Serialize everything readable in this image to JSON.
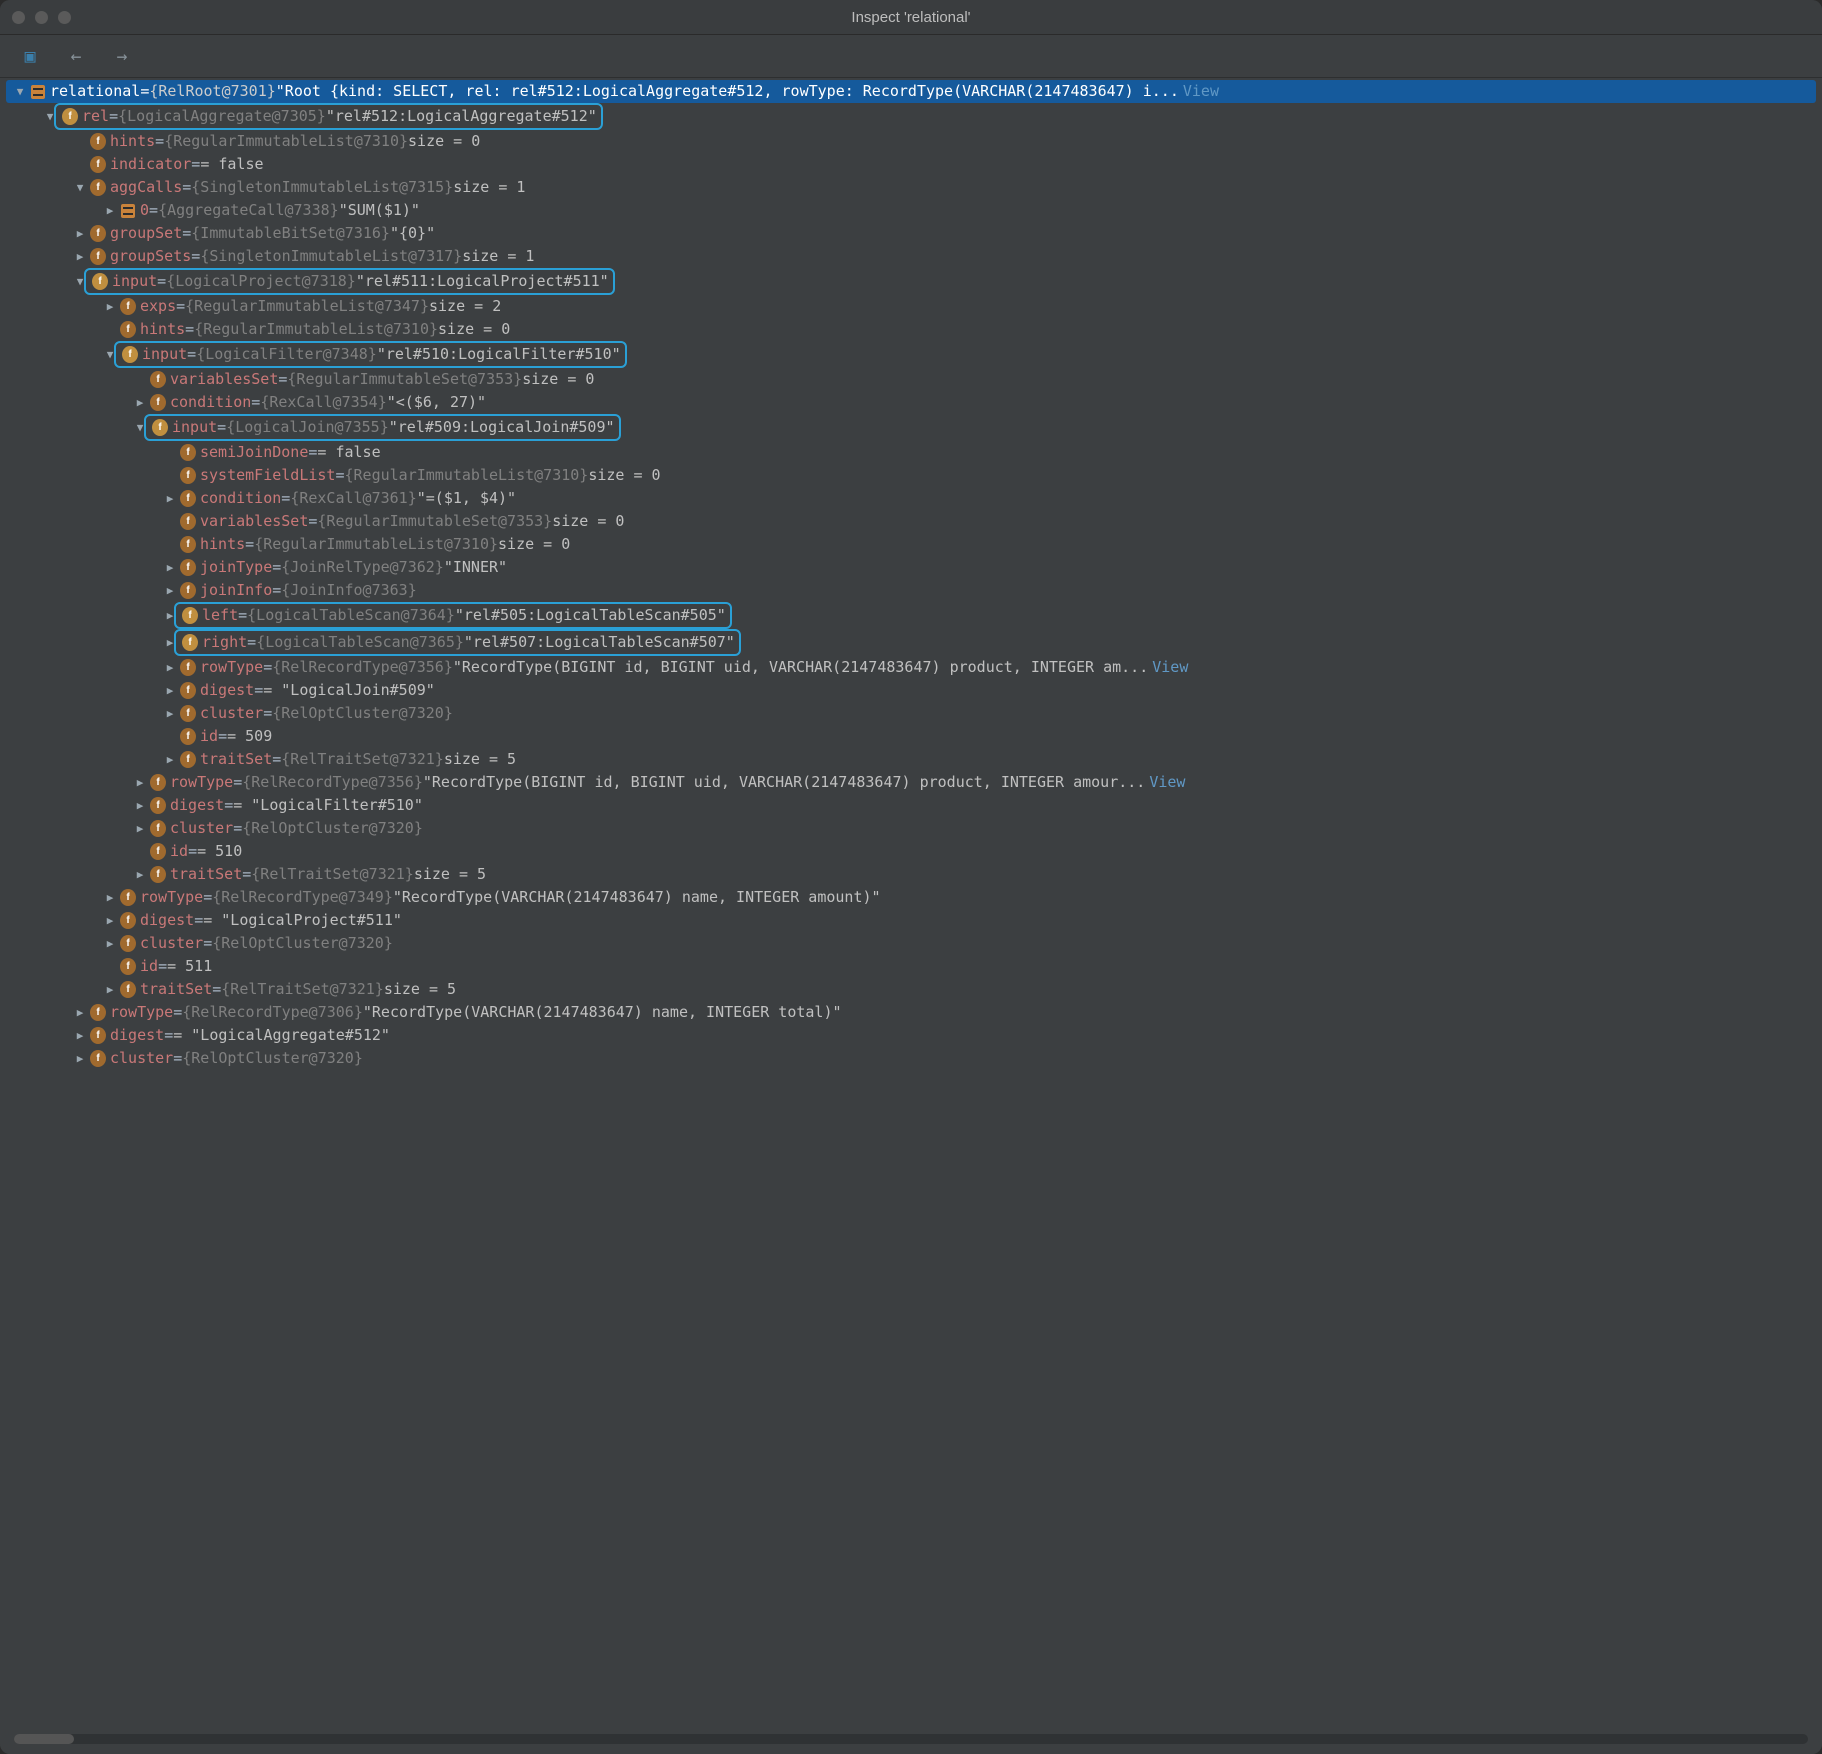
{
  "window": {
    "title": "Inspect 'relational'"
  },
  "tree": [
    {
      "indent": 0,
      "arrow": "down",
      "icon": "array",
      "selected": true,
      "keyClass": "key-sel",
      "key": "relational",
      "typeLabel": "{RelRoot@7301}",
      "value": "\"Root {kind: SELECT, rel: rel#512:LogicalAggregate#512, rowType: RecordType(VARCHAR(2147483647) i...",
      "extra": "View"
    },
    {
      "indent": 1,
      "arrow": "down",
      "hl": true,
      "icon": "f",
      "key": "rel",
      "typeLabel": "{LogicalAggregate@7305}",
      "value": "\"rel#512:LogicalAggregate#512\""
    },
    {
      "indent": 2,
      "arrow": "",
      "icon": "p",
      "key": "hints",
      "typeLabel": "{RegularImmutableList@7310}",
      "value": "size = 0"
    },
    {
      "indent": 2,
      "arrow": "",
      "icon": "p",
      "key": "indicator",
      "typeLabel": "",
      "value": "= false"
    },
    {
      "indent": 2,
      "arrow": "down",
      "icon": "p",
      "key": "aggCalls",
      "typeLabel": "{SingletonImmutableList@7315}",
      "value": "size = 1"
    },
    {
      "indent": 3,
      "arrow": "right",
      "icon": "array",
      "key": "0",
      "typeLabel": "{AggregateCall@7338}",
      "value": "\"SUM($1)\""
    },
    {
      "indent": 2,
      "arrow": "right",
      "icon": "p",
      "key": "groupSet",
      "typeLabel": "{ImmutableBitSet@7316}",
      "value": "\"{0}\""
    },
    {
      "indent": 2,
      "arrow": "right",
      "icon": "p",
      "key": "groupSets",
      "typeLabel": "{SingletonImmutableList@7317}",
      "value": "size = 1"
    },
    {
      "indent": 2,
      "arrow": "down",
      "hl": true,
      "icon": "f",
      "key": "input",
      "typeLabel": "{LogicalProject@7318}",
      "value": "\"rel#511:LogicalProject#511\""
    },
    {
      "indent": 3,
      "arrow": "right",
      "icon": "p",
      "key": "exps",
      "typeLabel": "{RegularImmutableList@7347}",
      "value": "size = 2"
    },
    {
      "indent": 3,
      "arrow": "",
      "icon": "p",
      "key": "hints",
      "typeLabel": "{RegularImmutableList@7310}",
      "value": "size = 0"
    },
    {
      "indent": 3,
      "arrow": "down",
      "hl": true,
      "icon": "f",
      "key": "input",
      "typeLabel": "{LogicalFilter@7348}",
      "value": "\"rel#510:LogicalFilter#510\""
    },
    {
      "indent": 4,
      "arrow": "",
      "icon": "p",
      "key": "variablesSet",
      "typeLabel": "{RegularImmutableSet@7353}",
      "value": "size = 0"
    },
    {
      "indent": 4,
      "arrow": "right",
      "icon": "p",
      "key": "condition",
      "typeLabel": "{RexCall@7354}",
      "value": "\"<($6, 27)\""
    },
    {
      "indent": 4,
      "arrow": "down",
      "hl": true,
      "icon": "f",
      "key": "input",
      "typeLabel": "{LogicalJoin@7355}",
      "value": "\"rel#509:LogicalJoin#509\""
    },
    {
      "indent": 5,
      "arrow": "",
      "icon": "p",
      "key": "semiJoinDone",
      "typeLabel": "",
      "value": "= false"
    },
    {
      "indent": 5,
      "arrow": "",
      "icon": "p",
      "key": "systemFieldList",
      "typeLabel": "{RegularImmutableList@7310}",
      "value": "size = 0"
    },
    {
      "indent": 5,
      "arrow": "right",
      "icon": "p",
      "key": "condition",
      "typeLabel": "{RexCall@7361}",
      "value": "\"=($1, $4)\""
    },
    {
      "indent": 5,
      "arrow": "",
      "icon": "p",
      "key": "variablesSet",
      "typeLabel": "{RegularImmutableSet@7353}",
      "value": "size = 0"
    },
    {
      "indent": 5,
      "arrow": "",
      "icon": "p",
      "key": "hints",
      "typeLabel": "{RegularImmutableList@7310}",
      "value": "size = 0"
    },
    {
      "indent": 5,
      "arrow": "right",
      "icon": "p",
      "key": "joinType",
      "typeLabel": "{JoinRelType@7362}",
      "value": "\"INNER\""
    },
    {
      "indent": 5,
      "arrow": "right",
      "icon": "p",
      "key": "joinInfo",
      "typeLabel": "{JoinInfo@7363}",
      "value": ""
    },
    {
      "indent": 5,
      "arrow": "right",
      "hl": true,
      "icon": "f",
      "key": "left",
      "typeLabel": "{LogicalTableScan@7364}",
      "value": "\"rel#505:LogicalTableScan#505\""
    },
    {
      "indent": 5,
      "arrow": "right",
      "hl": true,
      "icon": "f",
      "key": "right",
      "typeLabel": "{LogicalTableScan@7365}",
      "value": "\"rel#507:LogicalTableScan#507\""
    },
    {
      "indent": 5,
      "arrow": "right",
      "icon": "p",
      "key": "rowType",
      "typeLabel": "{RelRecordType@7356}",
      "value": "\"RecordType(BIGINT id, BIGINT uid, VARCHAR(2147483647) product, INTEGER am...",
      "extra": "View"
    },
    {
      "indent": 5,
      "arrow": "right",
      "icon": "p",
      "key": "digest",
      "typeLabel": "",
      "value": "= \"LogicalJoin#509\""
    },
    {
      "indent": 5,
      "arrow": "right",
      "icon": "p",
      "key": "cluster",
      "typeLabel": "{RelOptCluster@7320}",
      "value": ""
    },
    {
      "indent": 5,
      "arrow": "",
      "icon": "p",
      "key": "id",
      "typeLabel": "",
      "value": "= 509"
    },
    {
      "indent": 5,
      "arrow": "right",
      "icon": "p",
      "key": "traitSet",
      "typeLabel": "{RelTraitSet@7321}",
      "value": "size = 5"
    },
    {
      "indent": 4,
      "arrow": "right",
      "icon": "p",
      "key": "rowType",
      "typeLabel": "{RelRecordType@7356}",
      "value": "\"RecordType(BIGINT id, BIGINT uid, VARCHAR(2147483647) product, INTEGER amour...",
      "extra": "View"
    },
    {
      "indent": 4,
      "arrow": "right",
      "icon": "p",
      "key": "digest",
      "typeLabel": "",
      "value": "= \"LogicalFilter#510\""
    },
    {
      "indent": 4,
      "arrow": "right",
      "icon": "p",
      "key": "cluster",
      "typeLabel": "{RelOptCluster@7320}",
      "value": ""
    },
    {
      "indent": 4,
      "arrow": "",
      "icon": "p",
      "key": "id",
      "typeLabel": "",
      "value": "= 510"
    },
    {
      "indent": 4,
      "arrow": "right",
      "icon": "p",
      "key": "traitSet",
      "typeLabel": "{RelTraitSet@7321}",
      "value": "size = 5"
    },
    {
      "indent": 3,
      "arrow": "right",
      "icon": "p",
      "key": "rowType",
      "typeLabel": "{RelRecordType@7349}",
      "value": "\"RecordType(VARCHAR(2147483647) name, INTEGER amount)\""
    },
    {
      "indent": 3,
      "arrow": "right",
      "icon": "p",
      "key": "digest",
      "typeLabel": "",
      "value": "= \"LogicalProject#511\""
    },
    {
      "indent": 3,
      "arrow": "right",
      "icon": "p",
      "key": "cluster",
      "typeLabel": "{RelOptCluster@7320}",
      "value": ""
    },
    {
      "indent": 3,
      "arrow": "",
      "icon": "p",
      "key": "id",
      "typeLabel": "",
      "value": "= 511"
    },
    {
      "indent": 3,
      "arrow": "right",
      "icon": "p",
      "key": "traitSet",
      "typeLabel": "{RelTraitSet@7321}",
      "value": "size = 5"
    },
    {
      "indent": 2,
      "arrow": "right",
      "icon": "p",
      "key": "rowType",
      "typeLabel": "{RelRecordType@7306}",
      "value": "\"RecordType(VARCHAR(2147483647) name, INTEGER total)\""
    },
    {
      "indent": 2,
      "arrow": "right",
      "icon": "p",
      "key": "digest",
      "typeLabel": "",
      "value": "= \"LogicalAggregate#512\""
    },
    {
      "indent": 2,
      "arrow": "right",
      "icon": "p",
      "key": "cluster",
      "typeLabel": "{RelOptCluster@7320}",
      "value": ""
    }
  ]
}
